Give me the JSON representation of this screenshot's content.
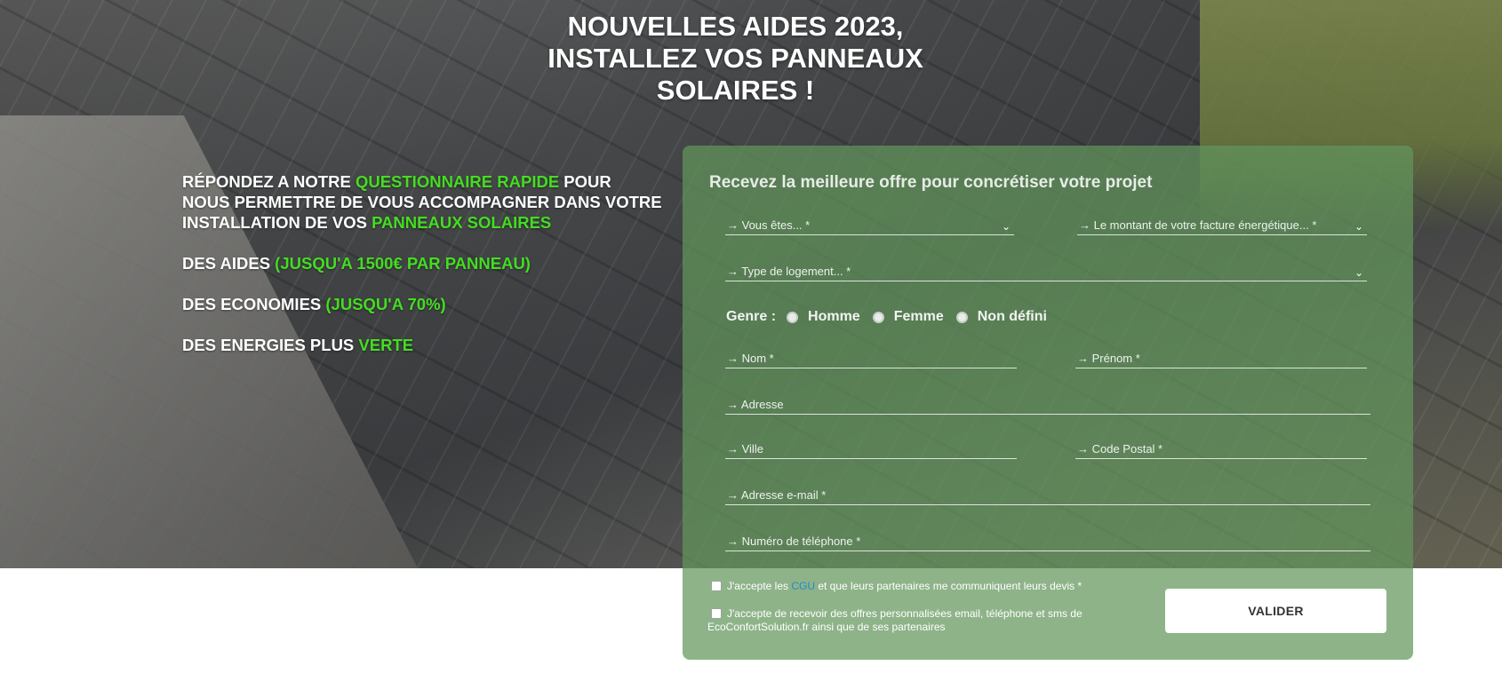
{
  "hero": {
    "title_lines": [
      "NOUVELLES AIDES 2023,",
      "INSTALLEZ VOS PANNEAUX",
      "SOLAIRES !"
    ]
  },
  "pitch": {
    "p1": {
      "a": "RÉPONDEZ A NOTRE ",
      "b": "QUESTIONNAIRE RAPIDE",
      "c": " POUR NOUS PERMETTRE DE VOUS ACCOMPAGNER DANS VOTRE INSTALLATION DE VOS ",
      "d": "PANNEAUX SOLAIRES"
    },
    "p2": {
      "a": "DES AIDES ",
      "b": "(JUSQU'A 1500€ PAR PANNEAU)"
    },
    "p3": {
      "a": "DES ECONOMIES ",
      "b": "(JUSQU'A 70%)"
    },
    "p4": {
      "a": "DES ENERGIES PLUS ",
      "b": "VERTE"
    }
  },
  "form": {
    "title": "Recevez la meilleure offre pour concrétiser votre projet",
    "vous_etes": "→ Vous êtes... *",
    "facture": "→ Le montant de votre facture énergétique... *",
    "logement": "→ Type de logement... *",
    "genre_label": "Genre :",
    "genre_options": [
      "Homme",
      "Femme",
      "Non défini"
    ],
    "nom": "→ Nom *",
    "prenom": "→ Prénom *",
    "adresse": "→ Adresse",
    "ville": "→ Ville",
    "code_postal": "→ Code Postal *",
    "email": "→ Adresse e-mail *",
    "telephone": "→ Numéro de téléphone *",
    "consent1": {
      "a": "J'accepte les ",
      "link": "CGU",
      "b": " et que leurs partenaires me communiquent leurs devis *"
    },
    "consent2": "J'accepte de recevoir des offres personnalisées email, téléphone et sms de EcoConfortSolution.fr ainsi que de ses partenaires",
    "submit_label": "VALIDER"
  },
  "colors": {
    "highlight": "#44dd22",
    "card": "#62965c",
    "link": "#1f8ec9"
  },
  "icons": {
    "select_arrow": "chevron-down-icon"
  }
}
